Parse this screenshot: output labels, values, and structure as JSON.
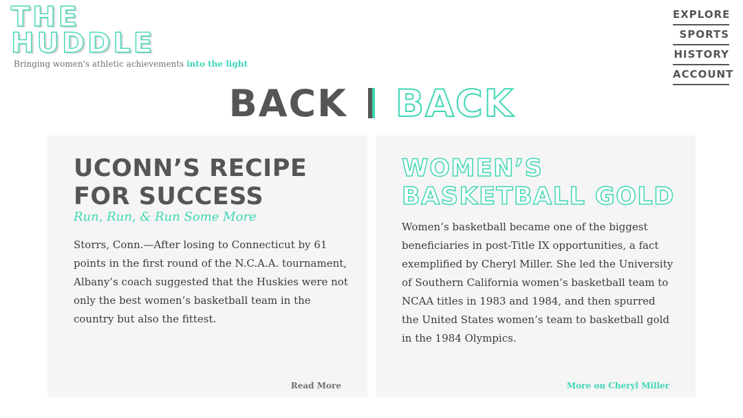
{
  "logo": {
    "line1": "THE",
    "line2": "HUDDLE"
  },
  "tagline": {
    "text": "Bringing women's athletic achievements",
    "accent": "into the light"
  },
  "nav": {
    "items": [
      "EXPLORE",
      "SPORTS",
      "HISTORY",
      "ACCOUNT"
    ]
  },
  "headline": {
    "left": "BACK",
    "right": "BACK"
  },
  "cards": [
    {
      "title": "UCONN’S RECIPE FOR SUCCESS",
      "subtitle": "Run, Run, & Run Some More",
      "body": "Storrs, Conn.—After losing to Connecticut by 61 points in the first round of the N.C.A.A. tournament, Albany’s coach suggested that the Huskies were not only the best women’s basketball team in the country but also the fittest.",
      "link": "Read More"
    },
    {
      "title": "WOMEN’S BASKETBALL GOLD",
      "body": "Women’s basketball became one of the biggest beneficiaries in post-Title IX opportunities, a fact exemplified by Cheryl Miller. She led the University of Southern California women’s basketball team to NCAA titles in 1983 and 1984, and then spurred the United States women’s team to basketball gold in the 1984 Olympics.",
      "link": "More on Cheryl Miller"
    }
  ],
  "colors": {
    "accent": "#3fd6b5",
    "text": "#555555",
    "card": "#f5f5f5"
  }
}
